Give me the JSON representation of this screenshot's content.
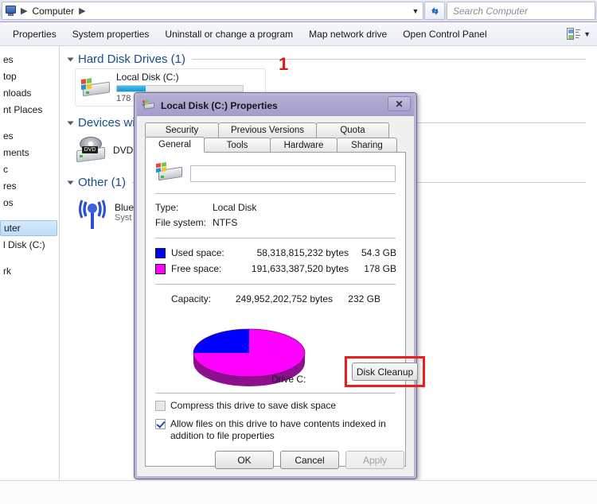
{
  "window": {
    "address": {
      "icon": "computer-icon",
      "crumbs": [
        "Computer"
      ],
      "dropdown_glyph": "▼",
      "refresh_glyph": "↻"
    },
    "search": {
      "placeholder": "Search Computer"
    }
  },
  "toolbar": {
    "items": [
      {
        "label": "Properties",
        "name": "toolbar-properties"
      },
      {
        "label": "System properties",
        "name": "toolbar-system-properties"
      },
      {
        "label": "Uninstall or change a program",
        "name": "toolbar-uninstall-program"
      },
      {
        "label": "Map network drive",
        "name": "toolbar-map-network-drive"
      },
      {
        "label": "Open Control Panel",
        "name": "toolbar-open-control-panel"
      }
    ],
    "view_dropdown_glyph": "▼"
  },
  "nav_pane": {
    "items": [
      {
        "label": "es",
        "full": "Favorites",
        "selected": false,
        "gap_after": false
      },
      {
        "label": "top",
        "full": "Desktop",
        "selected": false,
        "gap_after": false
      },
      {
        "label": "nloads",
        "full": "Downloads",
        "selected": false,
        "gap_after": false
      },
      {
        "label": "nt Places",
        "full": "Recent Places",
        "selected": false,
        "gap_after": true
      },
      {
        "label": "es",
        "full": "Libraries",
        "selected": false,
        "gap_after": false
      },
      {
        "label": "ments",
        "full": "Documents",
        "selected": false,
        "gap_after": false
      },
      {
        "label": "c",
        "full": "Music",
        "selected": false,
        "gap_after": false
      },
      {
        "label": "res",
        "full": "Pictures",
        "selected": false,
        "gap_after": false
      },
      {
        "label": "os",
        "full": "Videos",
        "selected": false,
        "gap_after": true
      },
      {
        "label": "uter",
        "full": "Computer",
        "selected": true,
        "gap_after": false
      },
      {
        "label": "l Disk (C:)",
        "full": "Local Disk (C:)",
        "selected": false,
        "gap_after": true
      },
      {
        "label": "rk",
        "full": "Network",
        "selected": false,
        "gap_after": false
      }
    ]
  },
  "content": {
    "annotation_number": "1",
    "groups": [
      {
        "title": "Hard Disk Drives (1)"
      },
      {
        "title": "Devices wi"
      },
      {
        "title": "Other (1)"
      }
    ],
    "hard_drive": {
      "name": "Local Disk (C:)",
      "free_text": "178",
      "usage_percent": 23
    },
    "dvd_drive": {
      "badge": "DVD",
      "name": "DVD"
    },
    "bluetooth_device": {
      "name": "Blue",
      "sub": "Syst"
    }
  },
  "dialog": {
    "title": "Local Disk (C:) Properties",
    "close_glyph": "✕",
    "tabs_top": [
      {
        "label": "Security",
        "active": false
      },
      {
        "label": "Previous Versions",
        "active": false
      },
      {
        "label": "Quota",
        "active": false
      }
    ],
    "tabs_bottom": [
      {
        "label": "General",
        "active": true
      },
      {
        "label": "Tools",
        "active": false
      },
      {
        "label": "Hardware",
        "active": false
      },
      {
        "label": "Sharing",
        "active": false
      }
    ],
    "volume_label": {
      "value": "",
      "placeholder": ""
    },
    "type": {
      "key": "Type:",
      "value": "Local Disk"
    },
    "file_system": {
      "key": "File system:",
      "value": "NTFS"
    },
    "used_space": {
      "label": "Used space:",
      "bytes": "58,318,815,232 bytes",
      "gb": "54.3 GB",
      "color": "#0000ff"
    },
    "free_space": {
      "label": "Free space:",
      "bytes": "191,633,387,520 bytes",
      "gb": "178 GB",
      "color": "#ff00ff"
    },
    "capacity": {
      "label": "Capacity:",
      "bytes": "249,952,202,752 bytes",
      "gb": "232 GB"
    },
    "drive_caption": "Drive C:",
    "disk_cleanup_button": "Disk Cleanup",
    "highlight_color": "#ee1c1c",
    "checkbox_compress": {
      "label": "Compress this drive to save disk space",
      "checked": false
    },
    "checkbox_index": {
      "label": "Allow files on this drive to have contents indexed in addition to file properties",
      "checked": true
    },
    "buttons": [
      {
        "label": "OK",
        "disabled": false,
        "name": "ok-button"
      },
      {
        "label": "Cancel",
        "disabled": false,
        "name": "cancel-button"
      },
      {
        "label": "Apply",
        "disabled": true,
        "name": "apply-button"
      }
    ]
  },
  "chart_data": {
    "type": "pie",
    "title": "Drive C: disk usage",
    "labels": [
      "Used space",
      "Free space"
    ],
    "values": [
      58318815232,
      191633387520
    ],
    "percentages": [
      23.3,
      76.7
    ],
    "value_labels": [
      "54.3 GB",
      "178 GB"
    ],
    "colors": [
      "#0000ff",
      "#ff00ff"
    ],
    "total": 249952202752,
    "total_label": "232 GB",
    "legend": "inline-swatches",
    "style": "3d-pie"
  }
}
